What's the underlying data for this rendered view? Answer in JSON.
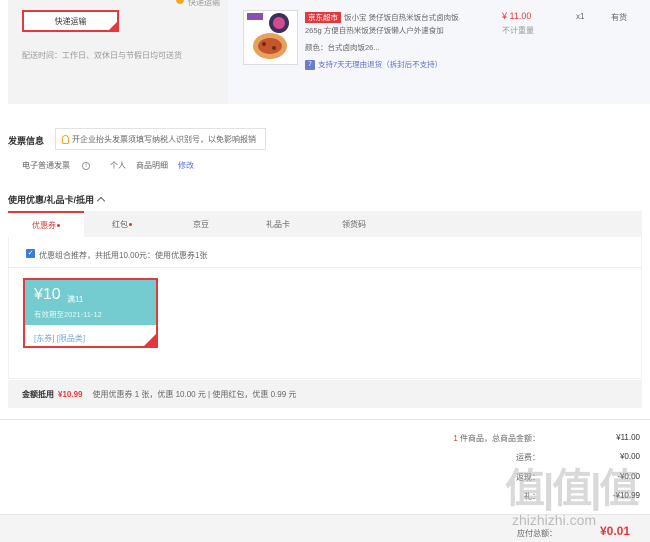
{
  "shipping": {
    "top_label": "快递运输",
    "method_button": "快递运输",
    "delivery_time": "配送时间：工作日、双休日与节假日均可送货"
  },
  "product": {
    "tag": "京东超市",
    "title": "饭小宝 煲仔饭自热米饭台式卤肉饭265g 方便自热米饭煲仔饭懒人户外速食加",
    "color": "颜色：台式卤肉饭26...",
    "support": "支持7天无理由退货（拆封后不支持）",
    "support_icon": "7",
    "price": "¥ 11.00",
    "weight": "不计重量",
    "quantity": "x1",
    "stock": "有货"
  },
  "invoice": {
    "title": "发票信息",
    "tip": "开企业抬头发票须填写纳税人识别号，以免影响报销",
    "type": "电子普通发票",
    "info_icon": "i",
    "holder": "个人",
    "content": "商品明细",
    "edit": "修改"
  },
  "coupons": {
    "title": "使用优惠/礼品卡/抵用",
    "tabs": [
      {
        "label": "优惠券",
        "dot": true
      },
      {
        "label": "红包",
        "dot": true
      },
      {
        "label": "京豆",
        "dot": false
      },
      {
        "label": "礼品卡",
        "dot": false
      },
      {
        "label": "领货码",
        "dot": false
      }
    ],
    "check_mark": "✓",
    "combo_label": "优惠组合推荐，共抵用10.00元：使用优惠券1张",
    "card": {
      "amount": "¥10",
      "minimum": "满11",
      "expiry": "有效期至2021-11-12",
      "tags": "[东券]  [限品类]"
    },
    "summary_label": "金额抵用",
    "summary_amount": "¥10.99",
    "summary_detail": "使用优惠券 1 张，优惠 10.00 元  | 使用红包，优惠 0.99 元"
  },
  "totals": {
    "count_prefix": "1",
    "count_label": "件商品，总商品金额：",
    "goods_amount": "¥11.00",
    "freight_label": "运费：",
    "freight_value": "¥0.00",
    "row3_label": "返现：",
    "row3_value": "-¥0.00",
    "row4_label": "礼：",
    "row4_value": "-¥10.99",
    "payable_label": "应付总额：",
    "payable_value": "¥0.01"
  },
  "watermark": {
    "text": "值|值|值",
    "sub": "zhizhizhi.com"
  },
  "colors": {
    "accent": "#e4393c",
    "link": "#5b6fd2",
    "coupon": "#74ccd0"
  }
}
